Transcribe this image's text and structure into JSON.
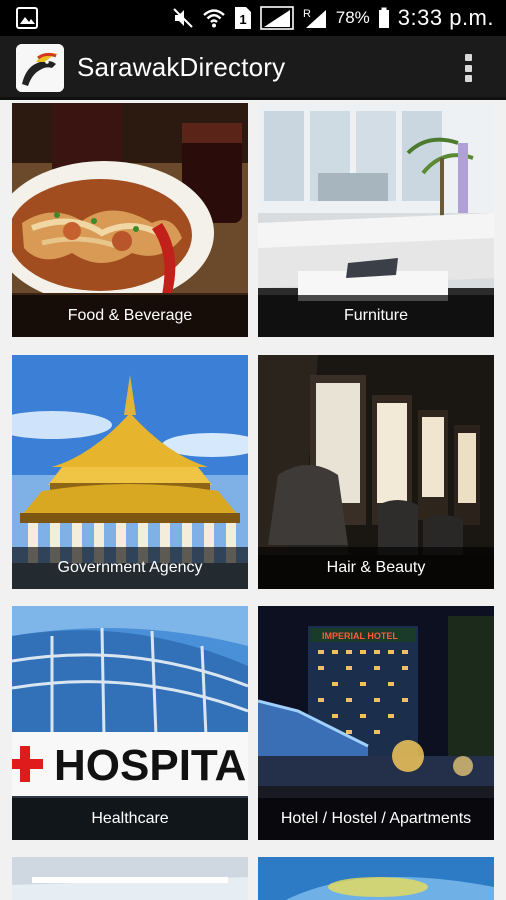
{
  "status_bar": {
    "battery_percent": "78%",
    "time": "3:33 p.m."
  },
  "app": {
    "title": "SarawakDirectory"
  },
  "categories": [
    {
      "label": "Food & Beverage"
    },
    {
      "label": "Furniture"
    },
    {
      "label": "Government Agency"
    },
    {
      "label": "Hair & Beauty"
    },
    {
      "label": "Healthcare"
    },
    {
      "label": "Hotel / Hostel / Apartments"
    }
  ],
  "hospital_sign": "HOSPITA",
  "hotel_sign": "IMPERIAL HOTEL"
}
